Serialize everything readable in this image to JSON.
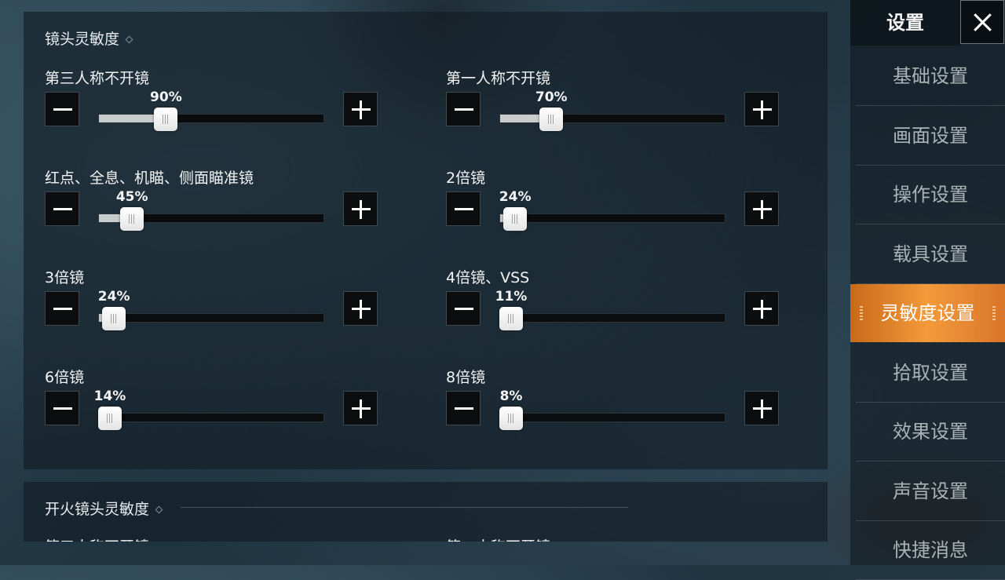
{
  "sensitivity_section": {
    "title": "镜头灵敏度",
    "settings": [
      {
        "label": "第三人称不开镜",
        "value_text": "90%",
        "value": 0.3
      },
      {
        "label": "第一人称不开镜",
        "value_text": "70%",
        "value": 0.23
      },
      {
        "label": "红点、全息、机瞄、侧面瞄准镜",
        "value_text": "45%",
        "value": 0.15
      },
      {
        "label": "2倍镜",
        "value_text": "24%",
        "value": 0.07
      },
      {
        "label": "3倍镜",
        "value_text": "24%",
        "value": 0.07
      },
      {
        "label": "4倍镜、VSS",
        "value_text": "11%",
        "value": 0.03
      },
      {
        "label": "6倍镜",
        "value_text": "14%",
        "value": 0.04
      },
      {
        "label": "8倍镜",
        "value_text": "8%",
        "value": 0.02
      }
    ]
  },
  "fire_section": {
    "title": "开火镜头灵敏度",
    "partial_left": "第三人称不开镜",
    "partial_right": "第一人称不开镜"
  },
  "sidebar": {
    "title": "设置",
    "items": [
      {
        "label": "基础设置",
        "active": false
      },
      {
        "label": "画面设置",
        "active": false
      },
      {
        "label": "操作设置",
        "active": false
      },
      {
        "label": "载具设置",
        "active": false
      },
      {
        "label": "灵敏度设置",
        "active": true
      },
      {
        "label": "拾取设置",
        "active": false
      },
      {
        "label": "效果设置",
        "active": false
      },
      {
        "label": "声音设置",
        "active": false
      },
      {
        "label": "快捷消息",
        "active": false
      }
    ]
  },
  "colors": {
    "accent": "#f39a3a",
    "slider_fill": "#c9cccd",
    "panel": "#121c24"
  }
}
